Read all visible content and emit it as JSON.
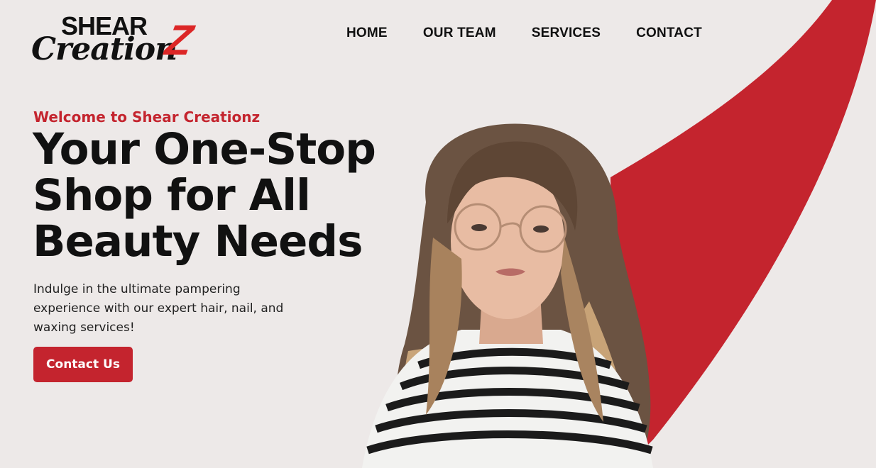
{
  "brand": {
    "top_text": "SHEAR",
    "bottom_text": "Creation",
    "accent_letter": "Z",
    "accent_color": "#dc2626"
  },
  "nav": {
    "items": [
      {
        "label": "HOME"
      },
      {
        "label": "OUR TEAM"
      },
      {
        "label": "SERVICES"
      },
      {
        "label": "CONTACT"
      }
    ]
  },
  "hero": {
    "eyebrow": "Welcome to Shear Creationz",
    "headline_lines": [
      "Your One-Stop",
      "Shop for All",
      "Beauty Needs"
    ],
    "description": "Indulge in the ultimate pampering experience with our expert hair, nail, and waxing services!",
    "cta_label": "Contact Us",
    "image": "woman-with-glasses-photo"
  },
  "colors": {
    "background": "#ede9e8",
    "accent": "#c4242e",
    "text": "#111111"
  }
}
